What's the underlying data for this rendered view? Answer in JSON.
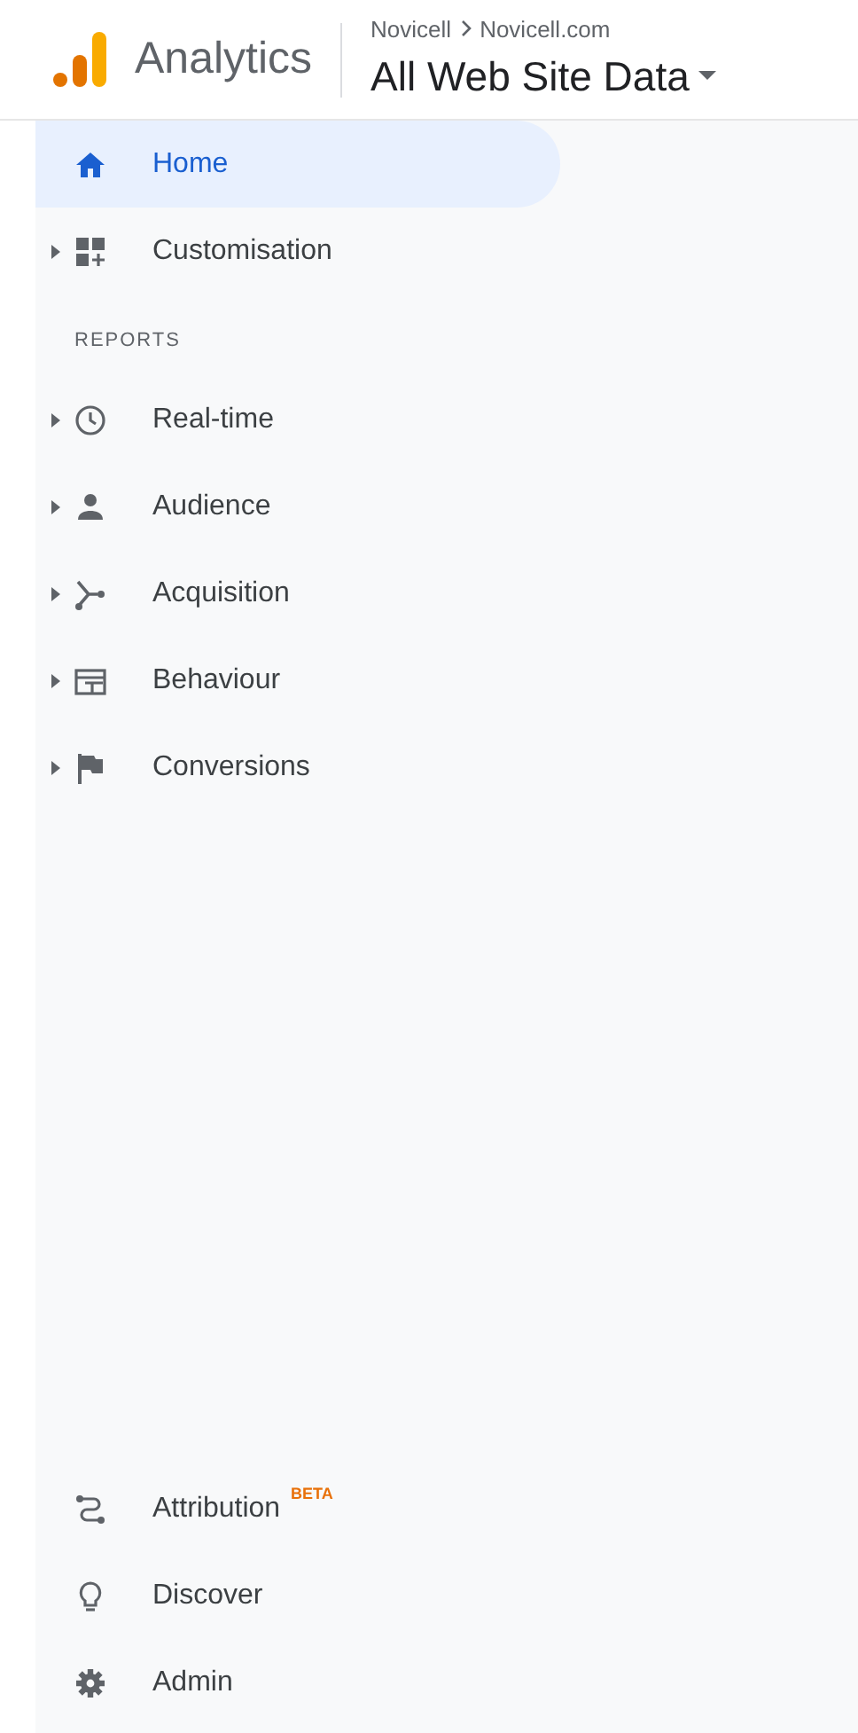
{
  "header": {
    "product": "Analytics",
    "breadcrumb": [
      "Novicell",
      "Novicell.com"
    ],
    "view": "All Web Site Data"
  },
  "nav": [
    {
      "label": "Home",
      "selected": true,
      "expandable": false
    },
    {
      "label": "Customisation",
      "selected": false,
      "expandable": true
    }
  ],
  "reports_heading": "REPORTS",
  "reports": [
    {
      "label": "Real-time",
      "selected": false,
      "expandable": true
    },
    {
      "label": "Audience",
      "selected": false,
      "expandable": true
    },
    {
      "label": "Acquisition",
      "selected": false,
      "expandable": true
    },
    {
      "label": "Behaviour",
      "selected": false,
      "expandable": true
    },
    {
      "label": "Conversions",
      "selected": false,
      "expandable": true
    }
  ],
  "bottom": [
    {
      "label": "Attribution",
      "badge": "BETA",
      "selected": false
    },
    {
      "label": "Discover",
      "selected": false
    },
    {
      "label": "Admin",
      "selected": false
    }
  ]
}
